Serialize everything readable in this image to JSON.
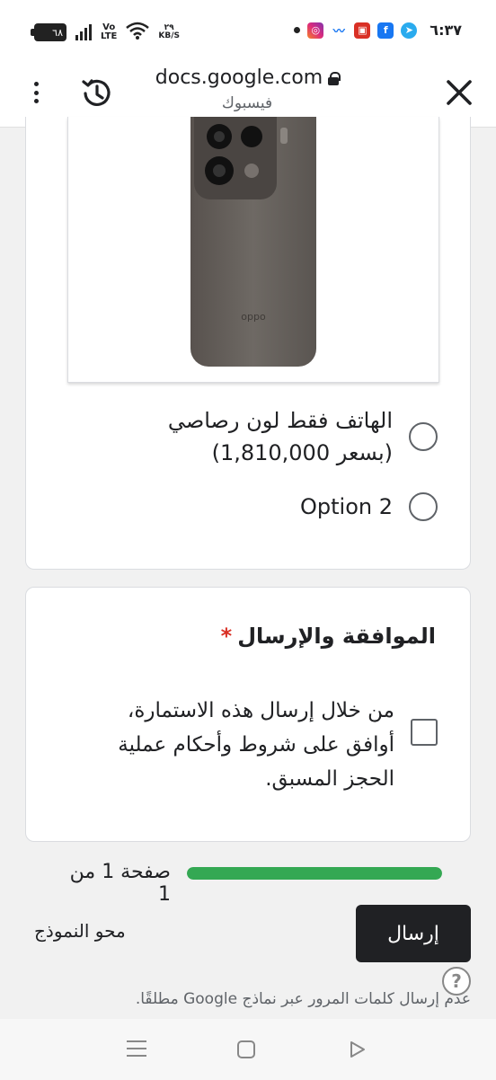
{
  "status_bar": {
    "battery": "٦٨",
    "volte_top": "Vo",
    "volte_bottom": "LTE",
    "net_speed_value": "٢٩",
    "net_speed_unit": "KB/S",
    "time": "٦:٣٧",
    "icons": [
      "battery-icon",
      "signal-icon",
      "volte-icon",
      "wifi-icon",
      "dot-icon",
      "instagram-icon",
      "messenger-icon",
      "app-icon",
      "facebook-icon",
      "telegram-icon"
    ]
  },
  "browser": {
    "url": "docs.google.com",
    "page_title": "فيسبوك",
    "icons": [
      "kebab-menu-icon",
      "history-icon",
      "lock-icon",
      "close-icon"
    ]
  },
  "question_options": {
    "options": [
      {
        "label": "الهاتف فقط لون رصاصي (بسعر 1,810,000)"
      },
      {
        "label": "Option 2"
      }
    ]
  },
  "consent": {
    "title": "الموافقة والإرسال",
    "required_mark": "*",
    "checkbox_label": "من خلال إرسال هذه الاستمارة، أوافق على شروط وأحكام عملية الحجز المسبق."
  },
  "footer": {
    "page_indicator": "صفحة 1 من 1",
    "progress_fraction": 1.0,
    "submit_label": "إرسال",
    "clear_label": "محو النموذج",
    "help_icon_label": "?",
    "password_warning": "عدم إرسال كلمات المرور عبر نماذج Google مطلقًا."
  },
  "colors": {
    "accent_progress": "#34a853",
    "submit_bg": "#202124",
    "required": "#d93025"
  }
}
